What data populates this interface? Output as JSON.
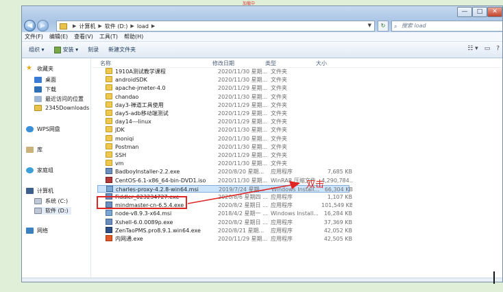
{
  "window": {
    "top_text": "加载中",
    "min": "—",
    "max": "□",
    "close": "✕"
  },
  "address": {
    "crumbs": [
      "计算机",
      "软件 (D:)",
      "load"
    ],
    "search_placeholder": "搜索 load"
  },
  "menu": [
    "文件(F)",
    "编辑(E)",
    "查看(V)",
    "工具(T)",
    "帮助(H)"
  ],
  "toolbar": {
    "organize": "组织 ▾",
    "install": "安装 ▾",
    "burn": "刻录",
    "new_folder": "新建文件夹"
  },
  "nav": {
    "favorites": "收藏夹",
    "desktop": "桌面",
    "downloads": "下载",
    "recent": "最近访问的位置",
    "downloads2345": "2345Downloads",
    "wps": "WPS网盘",
    "library": "库",
    "homegroup": "家庭组",
    "computer": "计算机",
    "drive_c": "系统 (C:)",
    "drive_d": "软件 (D:)",
    "network": "网络"
  },
  "columns": {
    "name": "名称",
    "date": "修改日期",
    "type": "类型",
    "size": "大小"
  },
  "files": [
    {
      "name": "1910A测试教学课程",
      "date": "2020/11/30 星期...",
      "type": "文件夹",
      "size": "",
      "icon": "folder"
    },
    {
      "name": "androidSDK",
      "date": "2020/11/30 星期...",
      "type": "文件夹",
      "size": "",
      "icon": "folder"
    },
    {
      "name": "apache-jmeter-4.0",
      "date": "2020/11/29 星期...",
      "type": "文件夹",
      "size": "",
      "icon": "folder"
    },
    {
      "name": "chandao",
      "date": "2020/11/30 星期...",
      "type": "文件夹",
      "size": "",
      "icon": "folder"
    },
    {
      "name": "day3-禅道工具使用",
      "date": "2020/11/29 星期...",
      "type": "文件夹",
      "size": "",
      "icon": "folder"
    },
    {
      "name": "day5-adb移动端测试",
      "date": "2020/11/29 星期...",
      "type": "文件夹",
      "size": "",
      "icon": "folder"
    },
    {
      "name": "day14---linux",
      "date": "2020/11/29 星期...",
      "type": "文件夹",
      "size": "",
      "icon": "folder"
    },
    {
      "name": "JDK",
      "date": "2020/11/30 星期...",
      "type": "文件夹",
      "size": "",
      "icon": "folder"
    },
    {
      "name": "moniqi",
      "date": "2020/11/30 星期...",
      "type": "文件夹",
      "size": "",
      "icon": "folder"
    },
    {
      "name": "Postman",
      "date": "2020/11/30 星期...",
      "type": "文件夹",
      "size": "",
      "icon": "folder"
    },
    {
      "name": "SSH",
      "date": "2020/11/29 星期...",
      "type": "文件夹",
      "size": "",
      "icon": "folder"
    },
    {
      "name": "vm",
      "date": "2020/11/30 星期...",
      "type": "文件夹",
      "size": "",
      "icon": "folder"
    },
    {
      "name": "BadboyInstaller-2.2.exe",
      "date": "2020/8/20 星期...",
      "type": "应用程序",
      "size": "7,685 KB",
      "icon": "exe"
    },
    {
      "name": "CentOS-6.1-x86_64-bin-DVD1.iso",
      "date": "2020/11/30 星期...",
      "type": "WinRAR 压缩文件",
      "size": "4,290,784...",
      "icon": "iso"
    },
    {
      "name": "charles-proxy-4.2.8-win64.msi",
      "date": "2019/7/24 星期...",
      "type": "Windows Install...",
      "size": "66,304 KB",
      "icon": "msi",
      "selected": true
    },
    {
      "name": "Fiddler_023234727.exe",
      "date": "2020/8/6 星期四 ...",
      "type": "应用程序",
      "size": "1,107 KB",
      "icon": "exe"
    },
    {
      "name": "mindmaster-cn-6.5.4.exe",
      "date": "2020/8/2 星期日 ...",
      "type": "应用程序",
      "size": "101,549 KB",
      "icon": "exe"
    },
    {
      "name": "node-v8.9.3-x64.msi",
      "date": "2018/4/2 星期一 ...",
      "type": "Windows Install...",
      "size": "16,284 KB",
      "icon": "msi"
    },
    {
      "name": "Xshell-6.0.0089p.exe",
      "date": "2020/8/2 星期日 ...",
      "type": "应用程序",
      "size": "37,369 KB",
      "icon": "exe"
    },
    {
      "name": "ZenTaoPMS.pro8.9.1.win64.exe",
      "date": "2020/8/21 星期...",
      "type": "应用程序",
      "size": "42,052 KB",
      "icon": "zentao"
    },
    {
      "name": "内网通.exe",
      "date": "2020/11/29 星期...",
      "type": "应用程序",
      "size": "42,505 KB",
      "icon": "neitong"
    }
  ],
  "annotation": {
    "text": "双击",
    "color": "#e02424"
  }
}
